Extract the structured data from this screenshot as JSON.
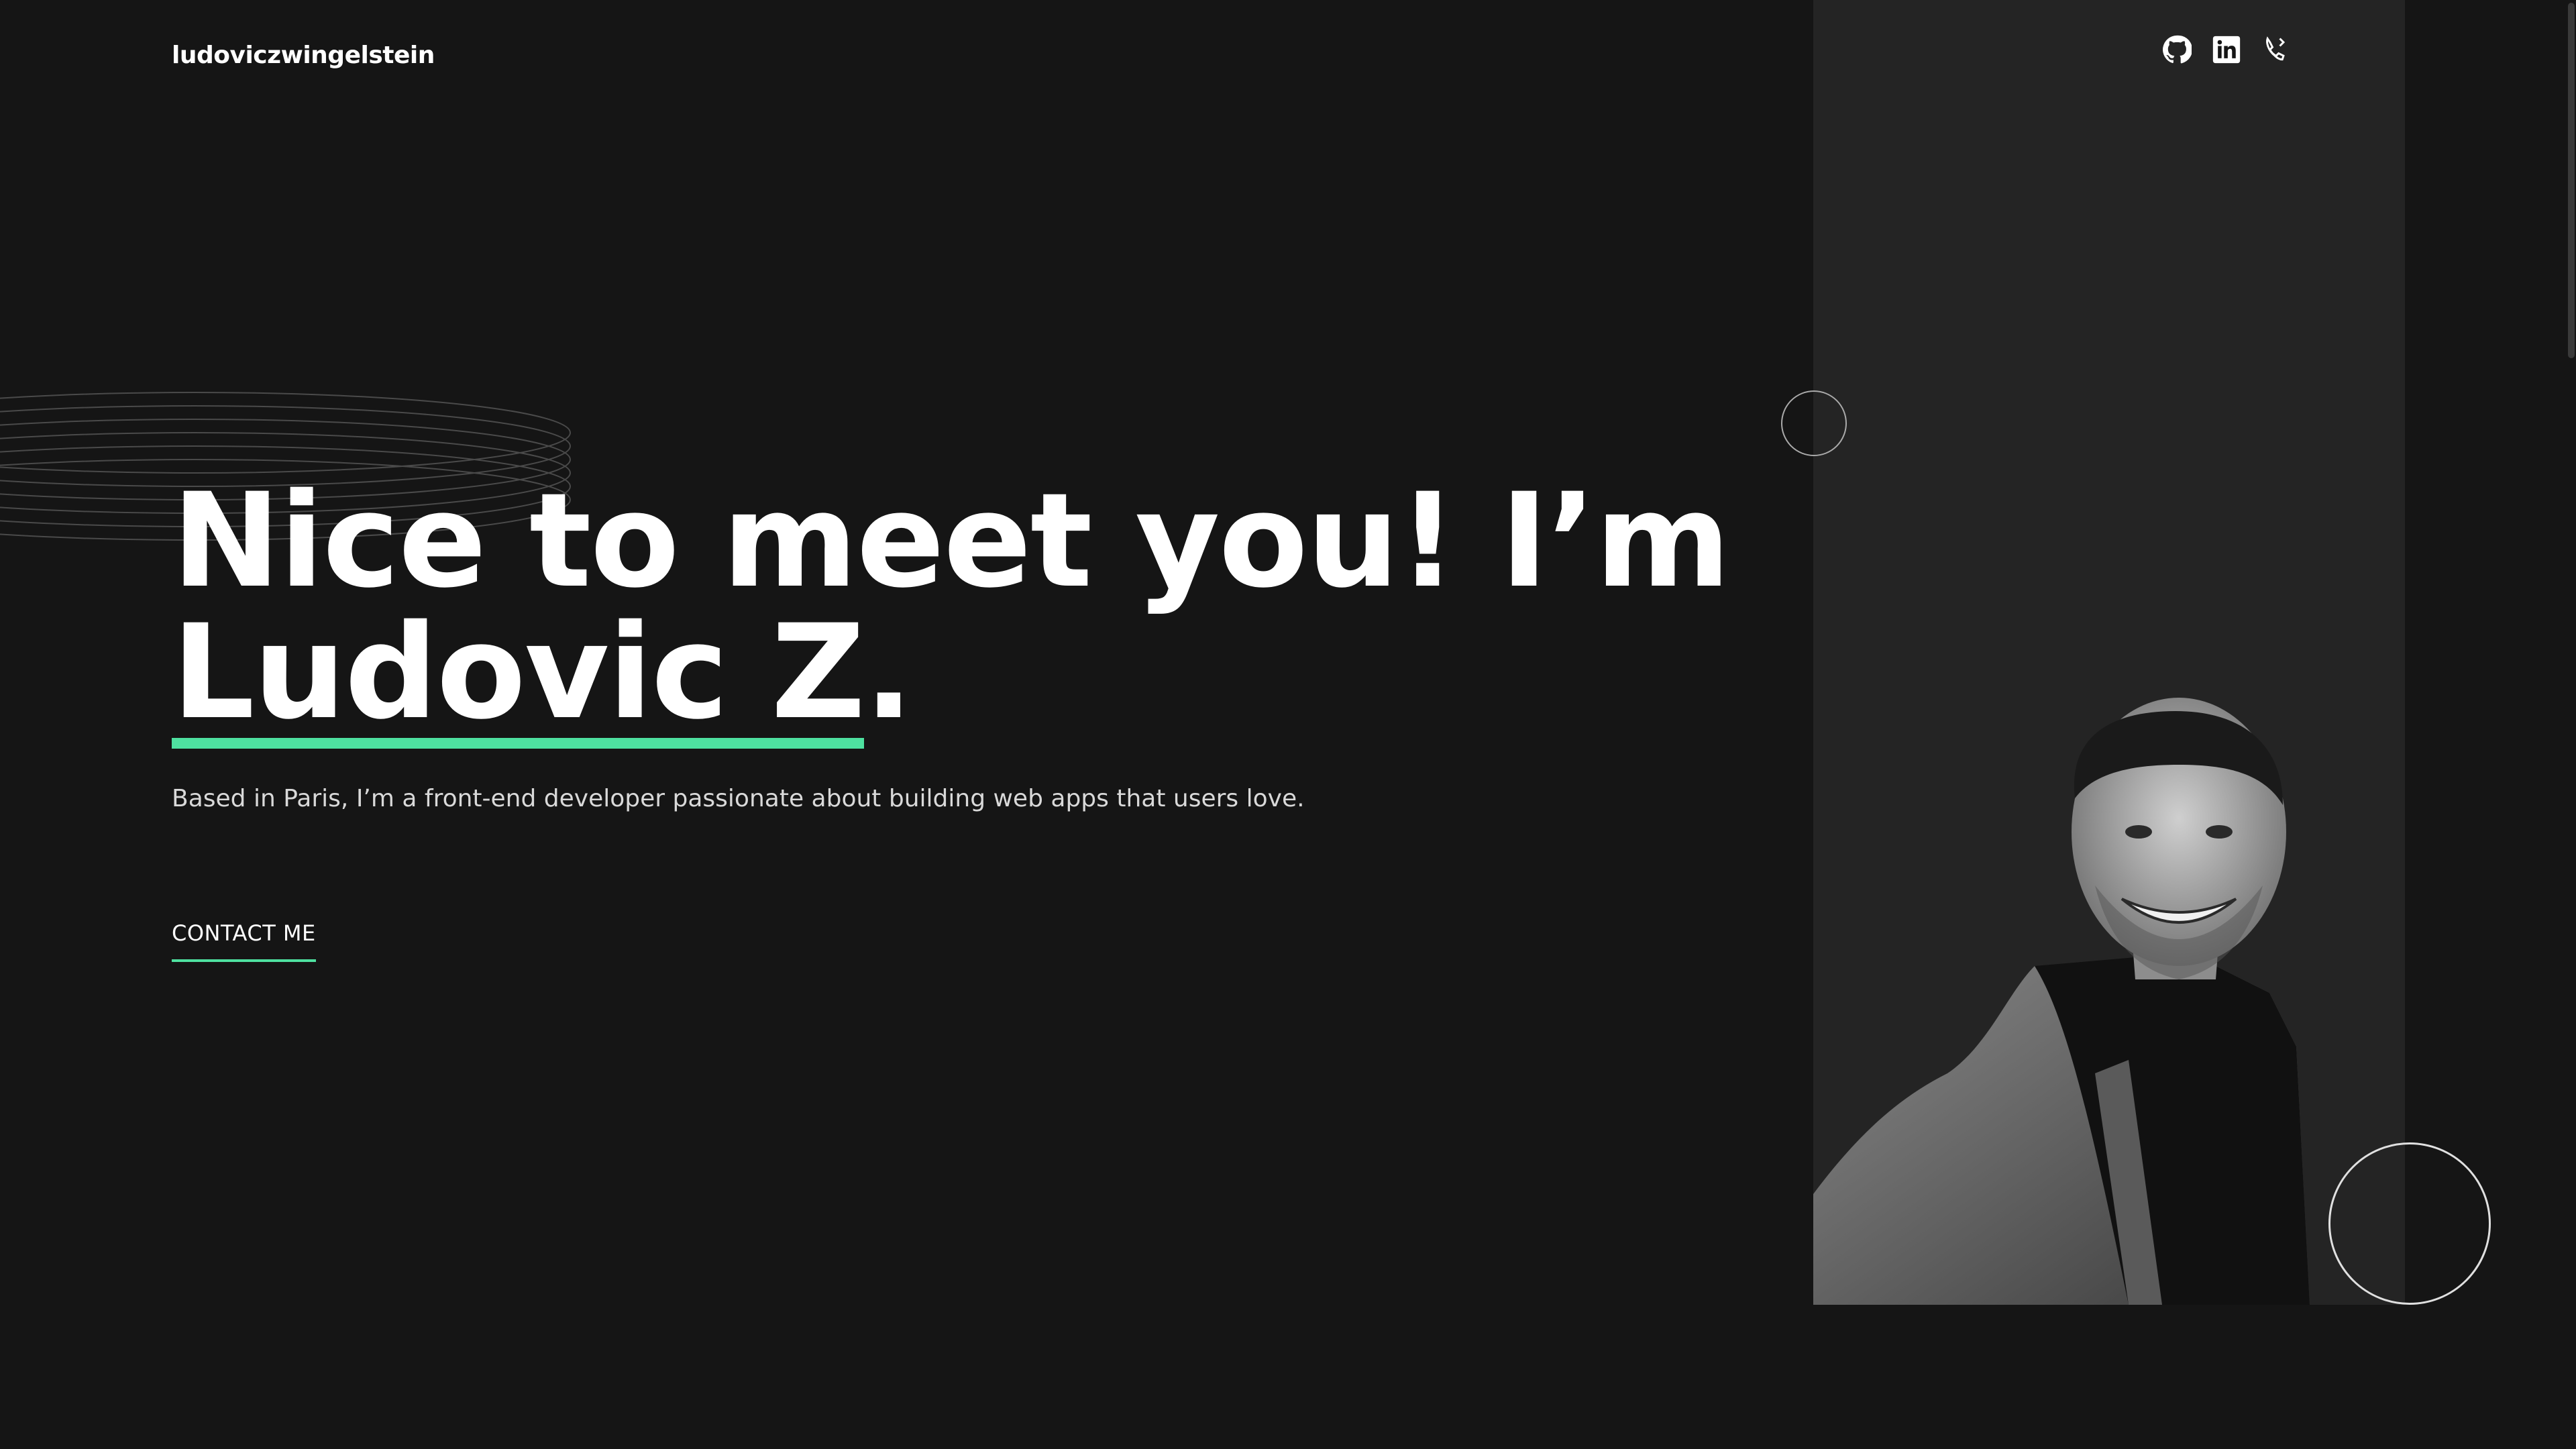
{
  "header": {
    "logo": "ludoviczwingelstein",
    "social": [
      {
        "icon": "github-icon"
      },
      {
        "icon": "linkedin-icon"
      },
      {
        "icon": "phone-icon"
      }
    ]
  },
  "hero": {
    "headline_line1": "Nice to meet you! I’m",
    "headline_name": "Ludovic Z",
    "headline_suffix": ".",
    "tagline": "Based in Paris, I’m a front-end developer passionate about building web apps that users love.",
    "cta_label": "CONTACT ME"
  },
  "colors": {
    "background": "#151515",
    "panel": "#242424",
    "accent": "#4ee1a0",
    "text": "#ffffff"
  }
}
